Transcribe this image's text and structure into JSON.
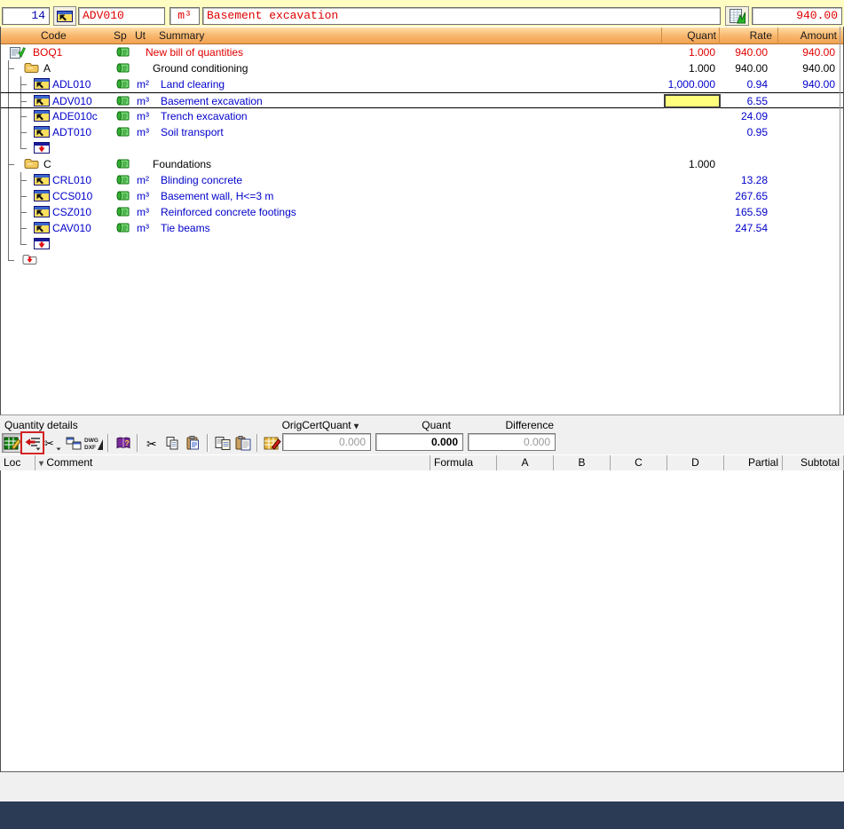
{
  "top_bar": {
    "row_number": "14",
    "code_value": "ADV010",
    "unit_value": "m³",
    "summary_value": "Basement excavation",
    "amount_value": "940.00"
  },
  "boq_table": {
    "headers": {
      "code": "Code",
      "sp": "Sp",
      "ut": "Ut",
      "summary": "Summary",
      "quant": "Quant",
      "rate": "Rate",
      "amount": "Amount"
    },
    "rows": [
      {
        "kind": "root",
        "level": 0,
        "code": "BOQ1",
        "sp": true,
        "unit": "",
        "summary": "New bill of quantities",
        "quant": "1.000",
        "rate": "940.00",
        "amount": "940.00",
        "color": "red"
      },
      {
        "kind": "chapter",
        "level": 1,
        "code": "A",
        "sp": true,
        "unit": "",
        "summary": "Ground conditioning",
        "quant": "1.000",
        "rate": "940.00",
        "amount": "940.00",
        "color": "black"
      },
      {
        "kind": "item",
        "level": 2,
        "code": "ADL010",
        "sp": true,
        "unit": "m²",
        "summary": "Land clearing",
        "quant": "1,000.000",
        "rate": "0.94",
        "amount": "940.00",
        "color": "blue"
      },
      {
        "kind": "item",
        "level": 2,
        "code": "ADV010",
        "sp": true,
        "unit": "m³",
        "summary": "Basement excavation",
        "quant": "",
        "rate": "6.55",
        "amount": "",
        "color": "blue",
        "selected": true,
        "quant_editing": true
      },
      {
        "kind": "item",
        "level": 2,
        "code": "ADE010c",
        "sp": true,
        "unit": "m³",
        "summary": "Trench excavation",
        "quant": "",
        "rate": "24.09",
        "amount": "",
        "color": "blue"
      },
      {
        "kind": "item",
        "level": 2,
        "code": "ADT010",
        "sp": true,
        "unit": "m³",
        "summary": "Soil transport",
        "quant": "",
        "rate": "0.95",
        "amount": "",
        "color": "blue"
      },
      {
        "kind": "placeholder-item",
        "level": 2
      },
      {
        "kind": "chapter",
        "level": 1,
        "code": "C",
        "sp": true,
        "unit": "",
        "summary": "Foundations",
        "quant": "1.000",
        "rate": "",
        "amount": "",
        "color": "black"
      },
      {
        "kind": "item",
        "level": 2,
        "code": "CRL010",
        "sp": true,
        "unit": "m²",
        "summary": "Blinding concrete",
        "quant": "",
        "rate": "13.28",
        "amount": "",
        "color": "blue"
      },
      {
        "kind": "item",
        "level": 2,
        "code": "CCS010",
        "sp": true,
        "unit": "m³",
        "summary": "Basement wall, H<=3 m",
        "quant": "",
        "rate": "267.65",
        "amount": "",
        "color": "blue"
      },
      {
        "kind": "item",
        "level": 2,
        "code": "CSZ010",
        "sp": true,
        "unit": "m³",
        "summary": "Reinforced concrete footings",
        "quant": "",
        "rate": "165.59",
        "amount": "",
        "color": "blue"
      },
      {
        "kind": "item",
        "level": 2,
        "code": "CAV010",
        "sp": true,
        "unit": "m³",
        "summary": "Tie beams",
        "quant": "",
        "rate": "247.54",
        "amount": "",
        "color": "blue"
      },
      {
        "kind": "placeholder-item",
        "level": 2
      },
      {
        "kind": "placeholder-chapter",
        "level": 1
      }
    ]
  },
  "quantity_details": {
    "title": "Quantity details",
    "toolbar": [
      {
        "name": "measurement-edit-icon",
        "pressed": true
      },
      {
        "name": "insert-lines-icon",
        "annotated": true
      },
      {
        "name": "split-lines-icon"
      },
      {
        "name": "copy-cells-icon"
      },
      {
        "name": "dwg-dxf-icon",
        "separator_after": true
      },
      {
        "name": "help-book-icon",
        "separator_after": true
      },
      {
        "name": "cut-icon"
      },
      {
        "name": "copy-icon"
      },
      {
        "name": "paste-icon",
        "separator_after": true
      },
      {
        "name": "copy-lines-icon"
      },
      {
        "name": "paste-lines-icon",
        "separator_after": true
      },
      {
        "name": "temp-measurement-icon"
      }
    ],
    "fields": [
      {
        "label": "OrigCertQuant",
        "value": "0.000",
        "muted": true,
        "dropdown": true
      },
      {
        "label": "Quant",
        "value": "0.000",
        "muted": false
      },
      {
        "label": "Difference",
        "value": "0.000",
        "muted": true
      }
    ],
    "columns": [
      "Loc",
      "Comment",
      "Formula",
      "A",
      "B",
      "C",
      "D",
      "Partial",
      "Subtotal"
    ]
  },
  "colors": {
    "topbar_bg": "#fffdc2",
    "header_gradient_top": "#ffdda6",
    "header_gradient_bottom": "#f1a152",
    "selection_yellow": "#ffff7d",
    "taskbar_navy": "#2b3a55",
    "value_red": "#e00000",
    "item_blue": "#0000cc",
    "annotation_red": "#d32222"
  }
}
